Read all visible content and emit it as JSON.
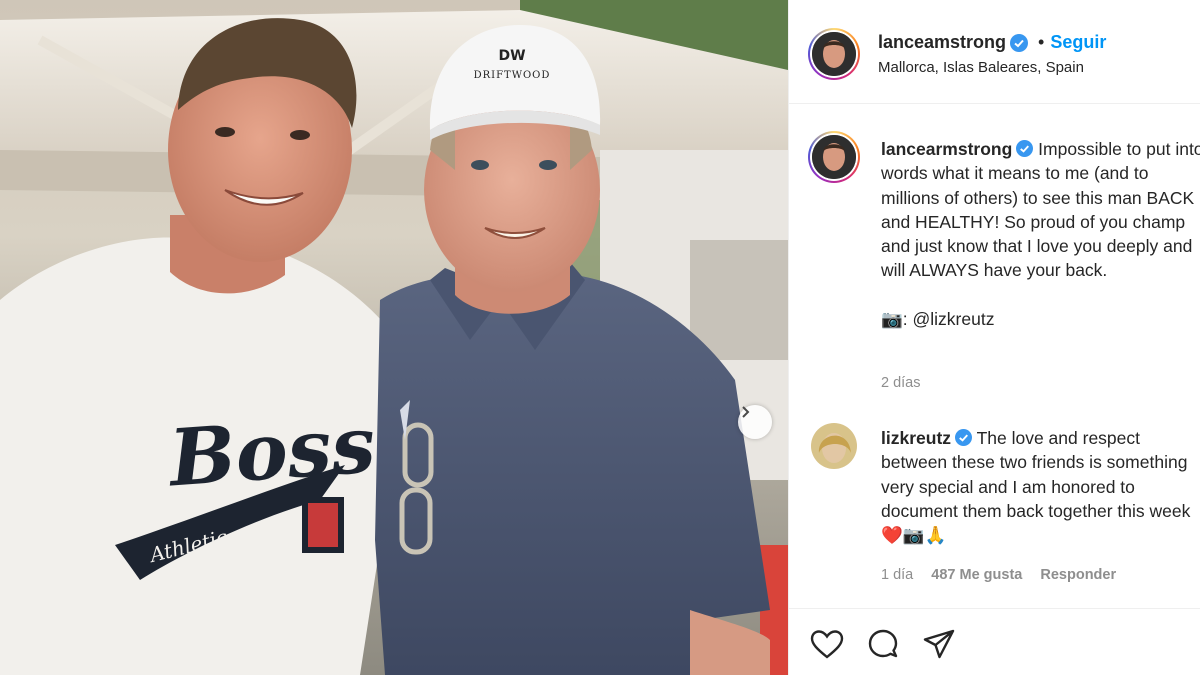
{
  "header": {
    "username": "lanceamstrong",
    "follow_label": "Seguir",
    "separator": "•",
    "location": "Mallorca, Islas Baleares, Spain"
  },
  "caption": {
    "username": "lancearmstrong",
    "text": "Impossible to put into words what it means to me (and to millions of others) to see this man BACK and HEALTHY! So proud of you champ and just know that I love you deeply and will ALWAYS have your back.",
    "credit_icon": "📷",
    "credit_text": ": @lizkreutz",
    "time": "2 días"
  },
  "reply_comment": {
    "username": "lizkreutz",
    "text": "The love and respect between these two friends is something very special and I am honored to document them back together this week",
    "emojis": [
      "❤️",
      "📷",
      "🙏"
    ],
    "time": "1 día",
    "likes": "487 Me gusta",
    "reply_label": "Responder"
  },
  "photo": {
    "cap_brand": "DRIFTWOOD",
    "cap_logo": "DW",
    "shirt_text": "Boss",
    "shirt_subtext": "Athletic"
  },
  "icons": {
    "verified": "verified-badge-icon",
    "like": "heart-icon",
    "comment": "comment-bubble-icon",
    "share": "paper-plane-icon",
    "next": "chevron-right-icon"
  },
  "colors": {
    "accent": "#0095f6",
    "text": "#262626",
    "muted": "#8e8e8e",
    "heart": "#e02424"
  }
}
